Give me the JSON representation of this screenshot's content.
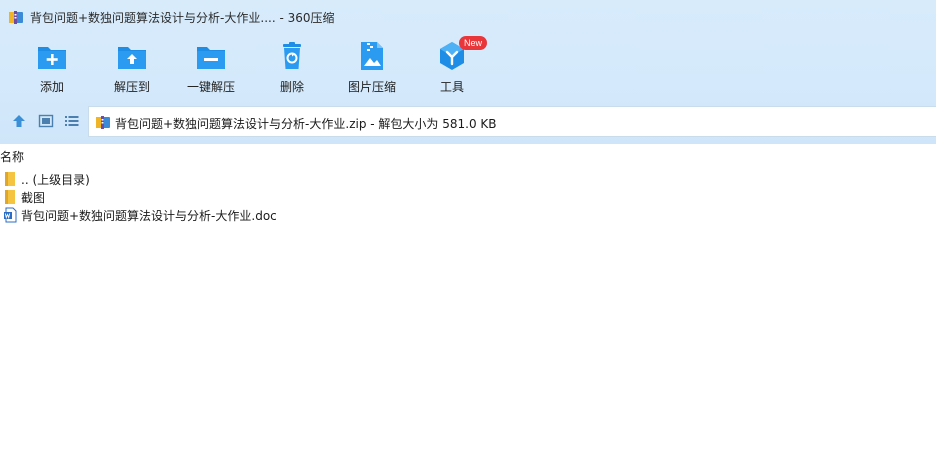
{
  "window": {
    "title": "背包问题+数独问题算法设计与分析-大作业.... - 360压缩"
  },
  "toolbar": {
    "items": [
      {
        "label": "添加",
        "icon": "folder-add-icon"
      },
      {
        "label": "解压到",
        "icon": "folder-extract-icon"
      },
      {
        "label": "一键解压",
        "icon": "one-click-extract-icon"
      },
      {
        "label": "删除",
        "icon": "trash-icon"
      },
      {
        "label": "图片压缩",
        "icon": "image-compress-icon"
      },
      {
        "label": "工具",
        "icon": "tools-icon",
        "badge": "New"
      }
    ]
  },
  "navbar": {
    "path": "背包问题+数独问题算法设计与分析-大作业.zip - 解包大小为 581.0 KB"
  },
  "filelist": {
    "column_name": "名称",
    "rows": [
      {
        "name": ".. (上级目录)",
        "type": "parent-folder"
      },
      {
        "name": "截图",
        "type": "folder"
      },
      {
        "name": "背包问题+数独问题算法设计与分析-大作业.doc",
        "type": "doc"
      }
    ]
  },
  "colors": {
    "accent": "#1d8de6",
    "toolbar_bg": "#d4e9fb",
    "badge": "#e8363b",
    "folder": "#f5c542"
  }
}
